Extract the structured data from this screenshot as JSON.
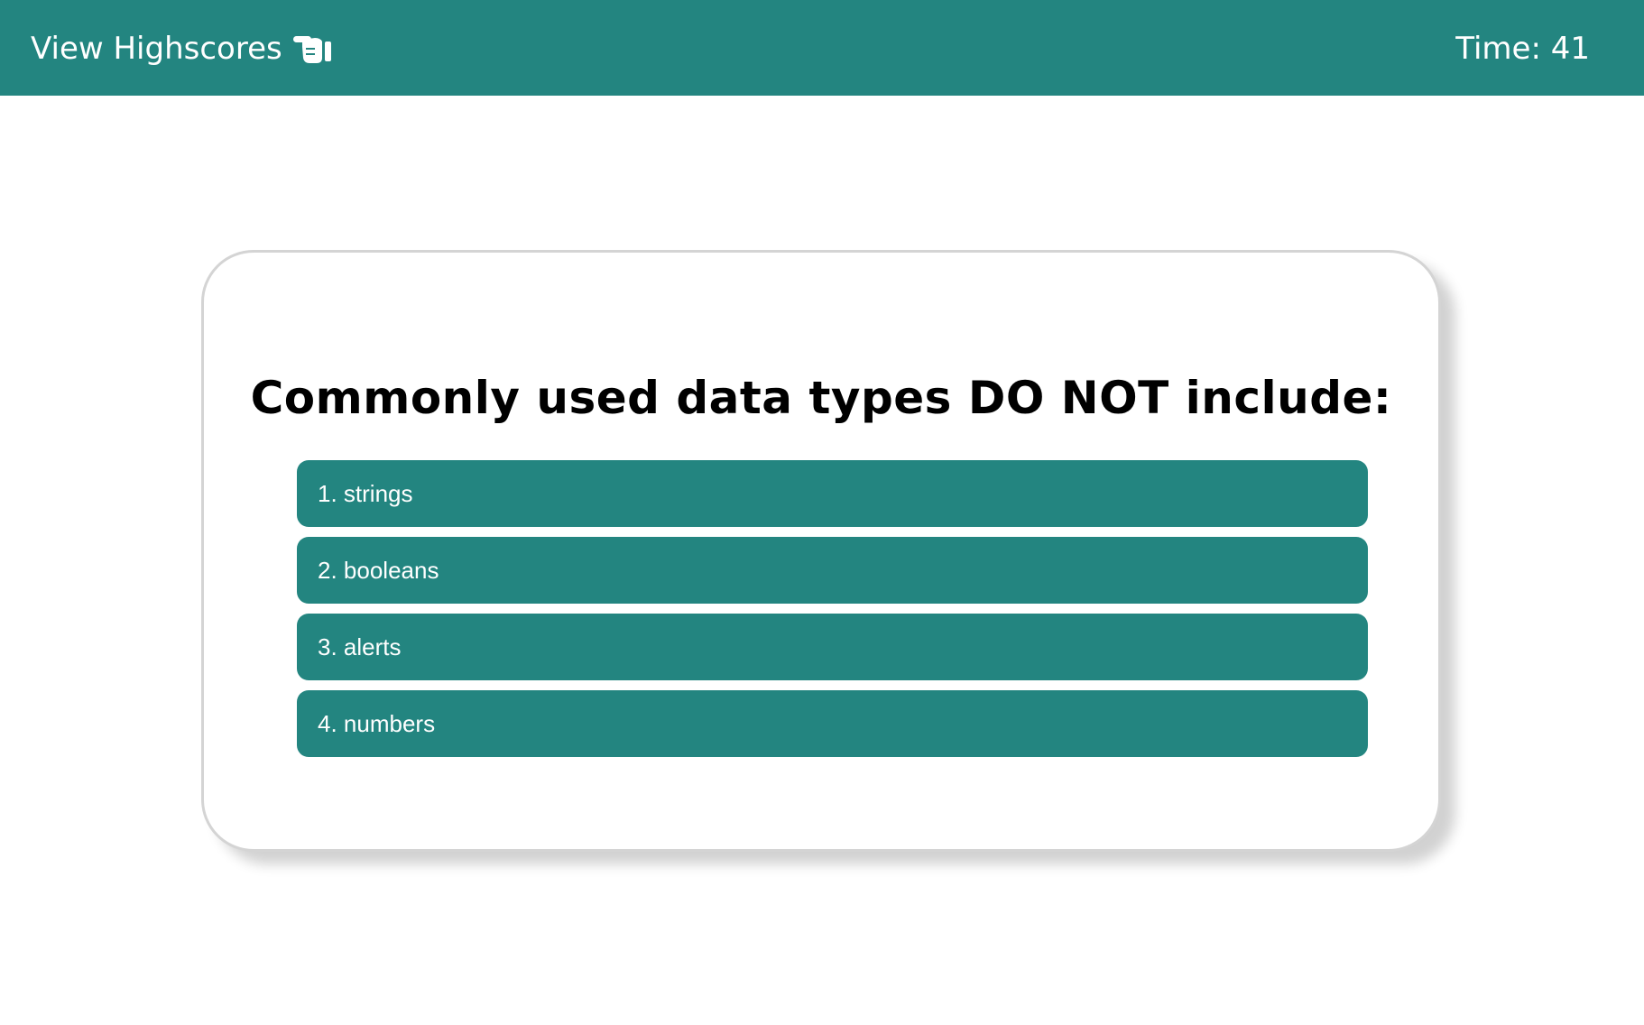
{
  "header": {
    "highscores_label": "View Highscores",
    "highscores_icon": "pointing-hand-icon",
    "timer_label": "Time:",
    "timer_value": "41",
    "bg_color": "#238580"
  },
  "quiz": {
    "question": "Commonly used data types DO NOT include:",
    "answers": [
      {
        "label": "1. strings"
      },
      {
        "label": "2. booleans"
      },
      {
        "label": "3. alerts"
      },
      {
        "label": "4. numbers"
      }
    ],
    "button_color": "#238580"
  }
}
